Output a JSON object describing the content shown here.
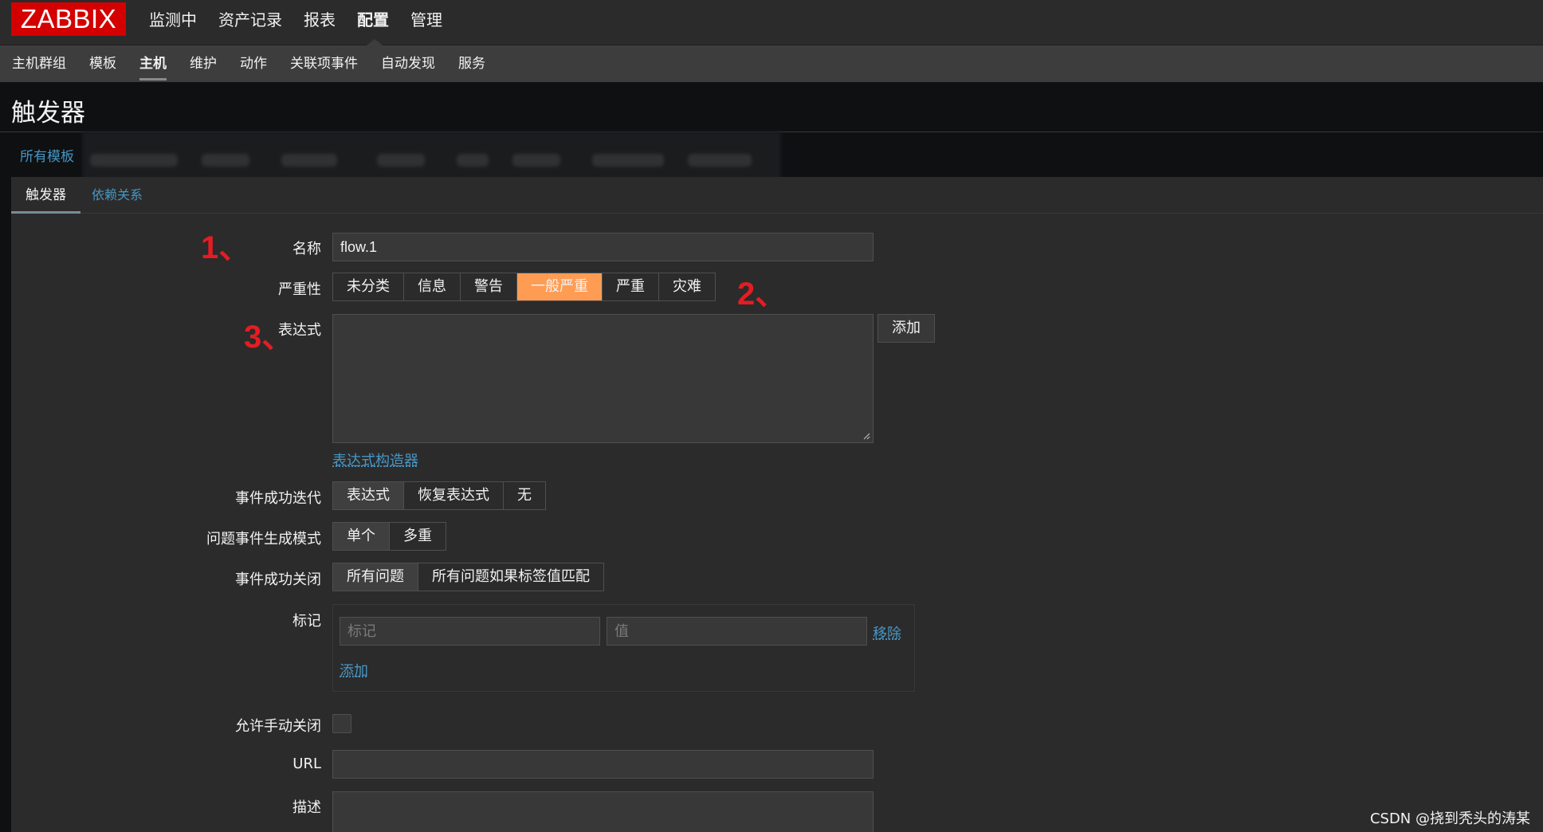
{
  "app": {
    "logo": "ZABBIX"
  },
  "topmenu": [
    "监测中",
    "资产记录",
    "报表",
    "配置",
    "管理"
  ],
  "submenu": [
    "主机群组",
    "模板",
    "主机",
    "维护",
    "动作",
    "关联项事件",
    "自动发现",
    "服务"
  ],
  "page": {
    "title": "触发器",
    "breadcrumb": "所有模板"
  },
  "tabs": [
    "触发器",
    "依赖关系"
  ],
  "form": {
    "name": {
      "label": "名称",
      "value": "flow.1"
    },
    "severity": {
      "label": "严重性",
      "options": [
        "未分类",
        "信息",
        "警告",
        "一般严重",
        "严重",
        "灾难"
      ],
      "selected": "一般严重"
    },
    "expression": {
      "label": "表达式",
      "value": "",
      "add_button": "添加",
      "builder_link": "表达式构造器"
    },
    "ok_event": {
      "label": "事件成功迭代",
      "options": [
        "表达式",
        "恢复表达式",
        "无"
      ],
      "selected": "表达式"
    },
    "problem_mode": {
      "label": "问题事件生成模式",
      "options": [
        "单个",
        "多重"
      ],
      "selected": "单个"
    },
    "ok_close": {
      "label": "事件成功关闭",
      "options": [
        "所有问题",
        "所有问题如果标签值匹配"
      ],
      "selected": "所有问题"
    },
    "tags": {
      "label": "标记",
      "tag_placeholder": "标记",
      "value_placeholder": "值",
      "remove_link": "移除",
      "add_link": "添加"
    },
    "manual_close": {
      "label": "允许手动关闭",
      "checked": false
    },
    "url": {
      "label": "URL",
      "value": ""
    },
    "description": {
      "label": "描述",
      "value": ""
    }
  },
  "annotations": [
    "1、",
    "2、",
    "3、"
  ],
  "watermark": "CSDN @挠到秃头的涛某",
  "colors": {
    "accent_red": "#d40000",
    "severity_average": "#ff9c54",
    "link": "#4796c4",
    "annotation": "#e51c23"
  }
}
